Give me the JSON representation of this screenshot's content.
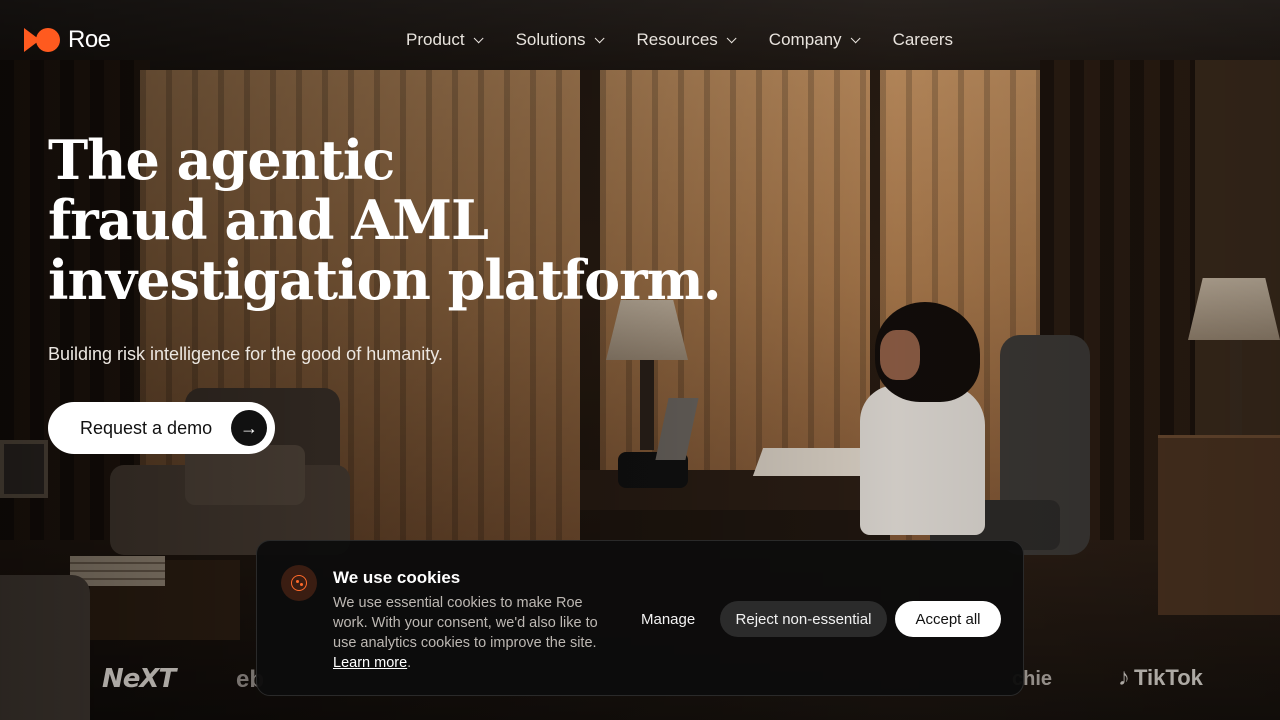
{
  "nav": {
    "brand": "Roe",
    "menu": [
      {
        "label": "Product",
        "has_dropdown": true
      },
      {
        "label": "Solutions",
        "has_dropdown": true
      },
      {
        "label": "Resources",
        "has_dropdown": true
      },
      {
        "label": "Company",
        "has_dropdown": true
      },
      {
        "label": "Careers",
        "has_dropdown": false
      }
    ]
  },
  "hero": {
    "title_lines": [
      "The agentic",
      "fraud and AML",
      "investigation platform."
    ],
    "subtitle": "Building risk intelligence for the good of humanity.",
    "cta_label": "Request a demo",
    "cta_icon": "arrow-right-icon"
  },
  "logos": {
    "next": "NeXT",
    "ebay_partial": "eb",
    "chie_partial": "chie",
    "tiktok": "TikTok"
  },
  "cookie_banner": {
    "title": "We use cookies",
    "body": "We use essential cookies to make Roe work. With your consent, we'd also like to use analytics cookies to improve the site.",
    "learn_more": "Learn more",
    "period": ".",
    "manage": "Manage",
    "reject": "Reject non-essential",
    "accept": "Accept all",
    "icon": "cookie-icon"
  },
  "colors": {
    "brand_accent": "#ff5a1f",
    "cta_bg": "#ffffff",
    "banner_bg": "#0c0c0c"
  }
}
